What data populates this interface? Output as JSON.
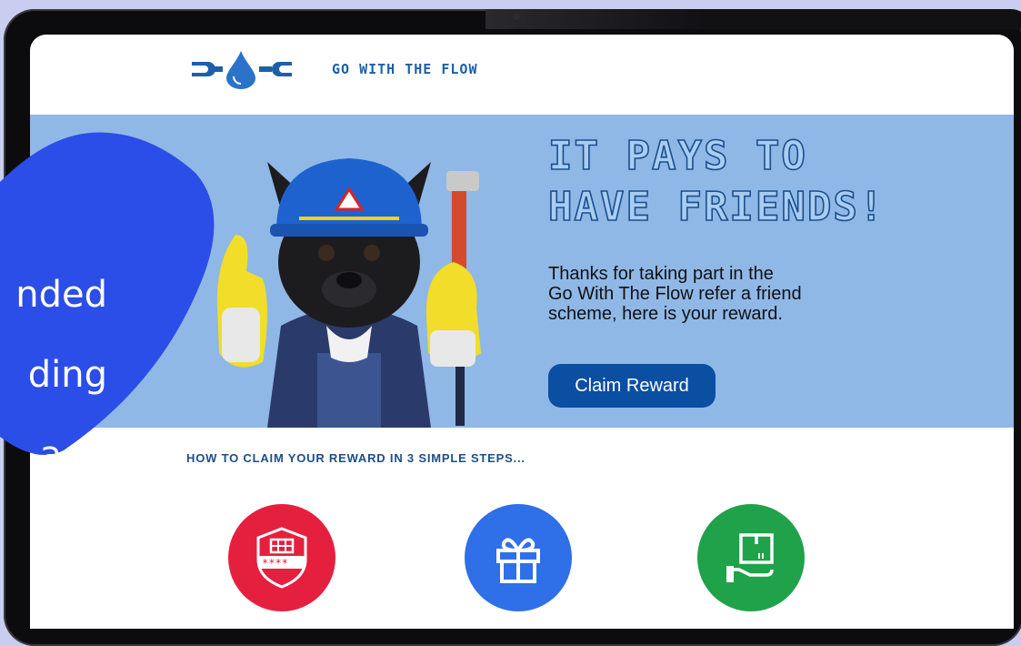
{
  "logo": {
    "text": "GO WITH THE FLOW"
  },
  "hero": {
    "title_line1": "IT PAYS TO",
    "title_line2": "HAVE FRIENDS!",
    "body_line1": "Thanks for taking part in the",
    "body_line2": "Go With The Flow refer a friend",
    "body_line3": "scheme, here is your reward.",
    "cta_label": "Claim Reward"
  },
  "steps": {
    "heading": "HOW TO CLAIM YOUR REWARD IN 3 SIMPLE STEPS...",
    "items": [
      {
        "icon": "password-shield-icon",
        "color": "#e5203f"
      },
      {
        "icon": "gift-icon",
        "color": "#2f6fe8"
      },
      {
        "icon": "package-hand-icon",
        "color": "#1fa24a"
      }
    ]
  },
  "overlay": {
    "line1": "nded",
    "line2": "ding",
    "line3": "age",
    "color": "#2b4de8"
  },
  "colors": {
    "hero_bg": "#8fb8e6",
    "cta": "#0b4fa3",
    "brand": "#1d5fa8"
  }
}
